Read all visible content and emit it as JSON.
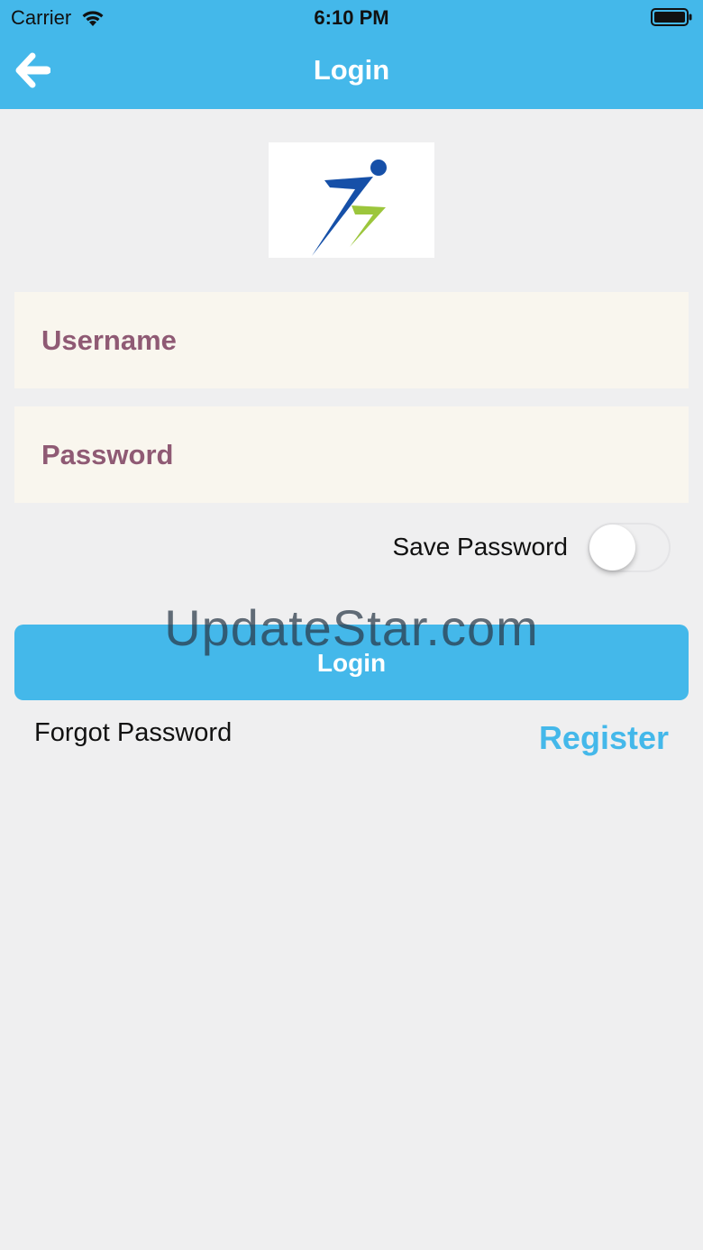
{
  "status_bar": {
    "carrier": "Carrier",
    "time": "6:10 PM",
    "icons": [
      "wifi-icon",
      "battery-icon"
    ]
  },
  "nav": {
    "title": "Login",
    "back_icon": "arrow-left-icon"
  },
  "logo": {
    "icon": "running-figure-logo"
  },
  "form": {
    "username_placeholder": "Username",
    "password_placeholder": "Password",
    "save_password_label": "Save Password",
    "save_password_on": false,
    "login_label": "Login"
  },
  "links": {
    "forgot_password": "Forgot Password",
    "register": "Register"
  },
  "watermark": "UpdateStar.com",
  "colors": {
    "accent": "#44b8ea",
    "field_bg": "#f9f6ee",
    "placeholder": "#8f5a74",
    "background": "#efeff0"
  }
}
